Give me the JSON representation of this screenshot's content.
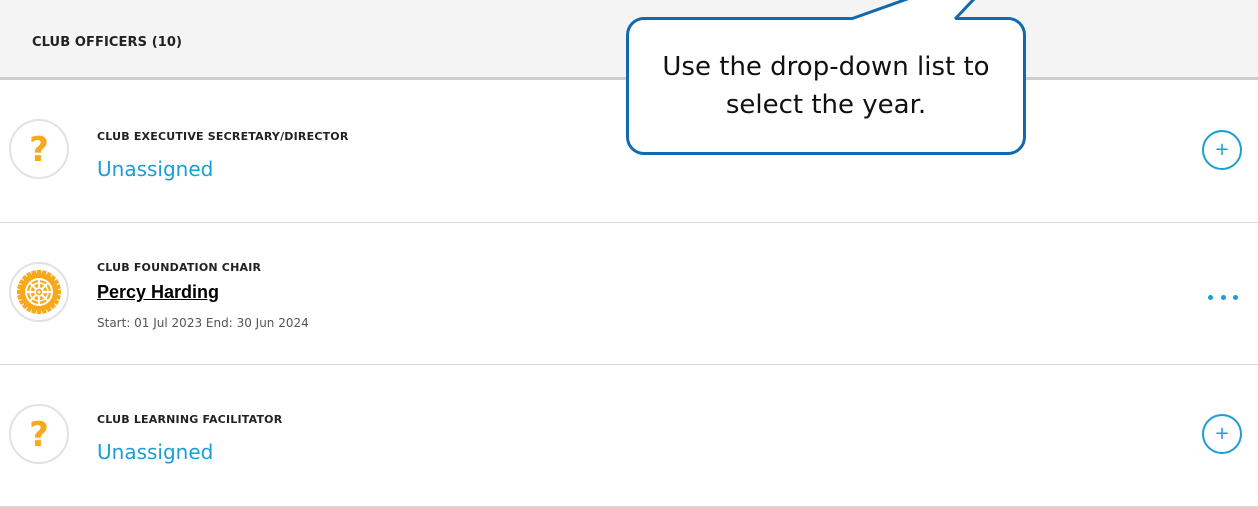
{
  "header": {
    "title": "CLUB OFFICERS (10)"
  },
  "officers": [
    {
      "role": "CLUB EXECUTIVE SECRETARY/DIRECTOR",
      "status": "Unassigned",
      "avatar_icon": "question-mark-icon",
      "action_icon": "plus-icon",
      "action_symbol": "+"
    },
    {
      "role": "CLUB FOUNDATION CHAIR",
      "name": "Percy Harding",
      "dates": "Start: 01 Jul 2023 End: 30 Jun 2024",
      "avatar_icon": "rotary-wheel-icon",
      "action_icon": "more-options-icon"
    },
    {
      "role": "CLUB LEARNING FACILITATOR",
      "status": "Unassigned",
      "avatar_icon": "question-mark-icon",
      "action_icon": "plus-icon",
      "action_symbol": "+"
    }
  ],
  "avatar_symbol": "?",
  "callout": {
    "text": "Use the drop-down list to select the year."
  },
  "colors": {
    "link_blue": "#1a9ed6",
    "rotary_gold": "#f7a81b",
    "callout_border": "#1269b0",
    "header_bg": "#f4f4f4"
  }
}
